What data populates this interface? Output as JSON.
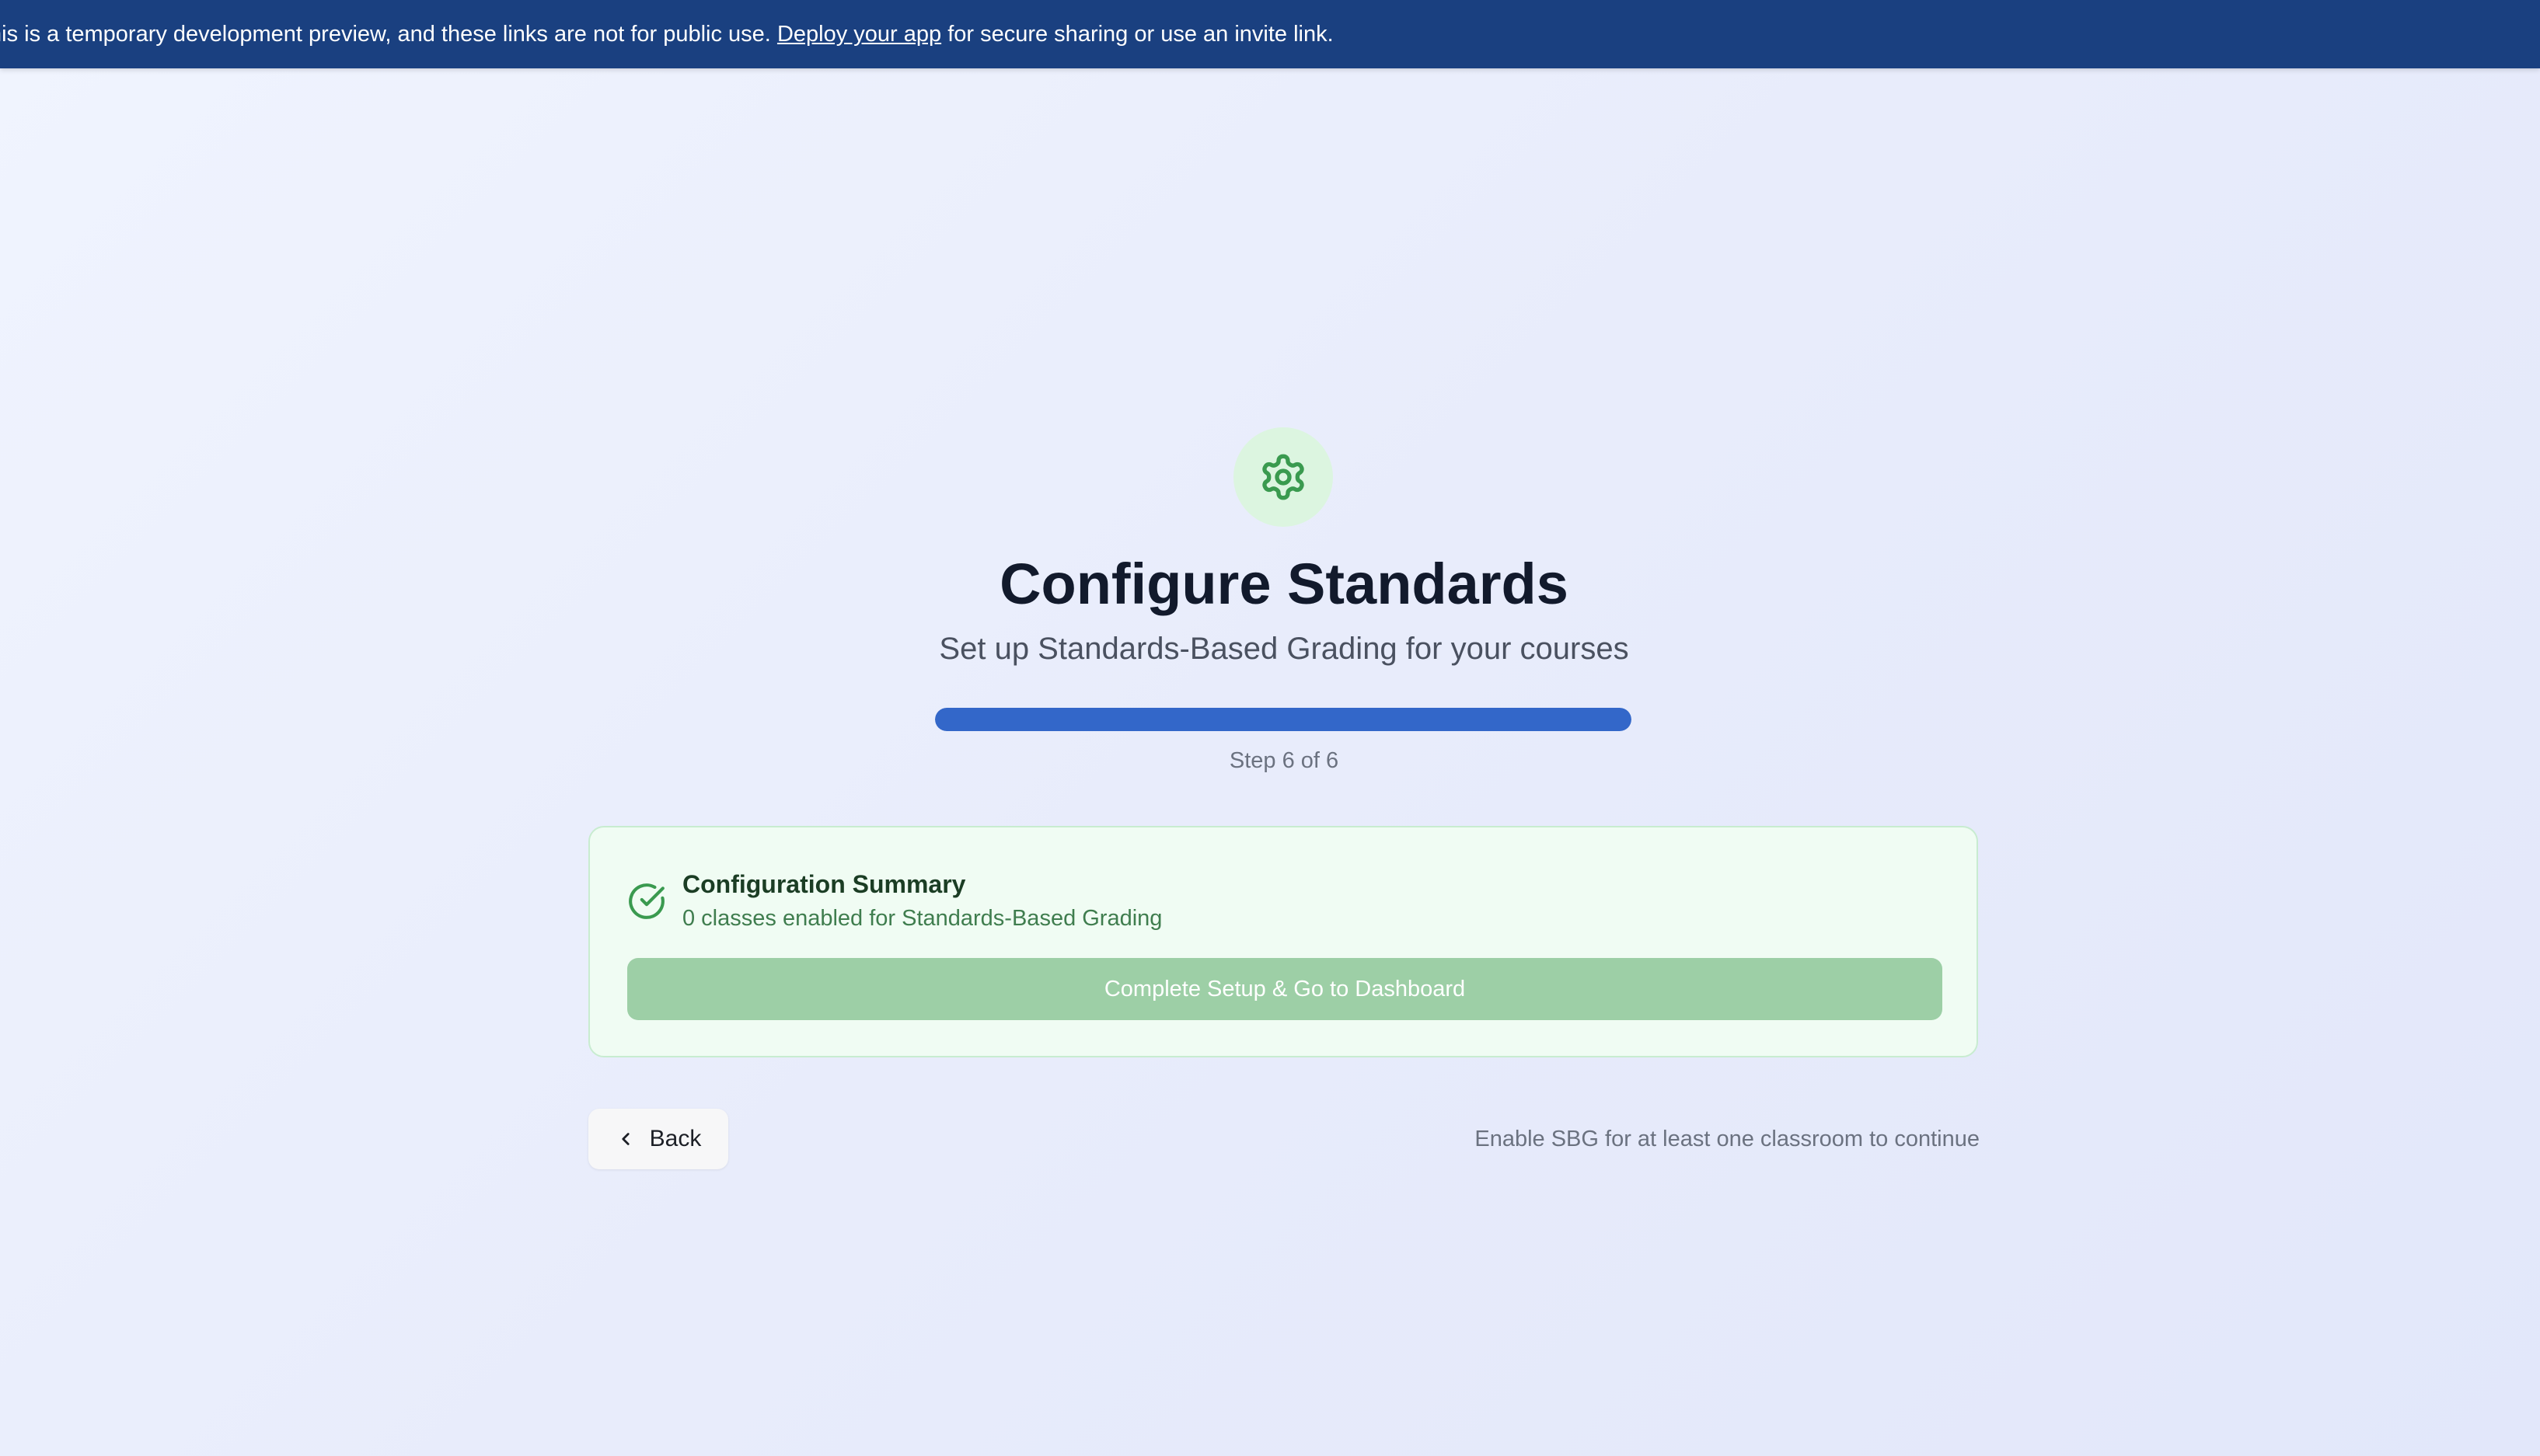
{
  "banner": {
    "text_before": "his is a temporary development preview, and these links are not for public use.",
    "link_text": "Deploy your app",
    "text_after": "for secure sharing or use an invite link."
  },
  "header": {
    "icon": "gear-icon",
    "title": "Configure Standards",
    "subtitle": "Set up Standards-Based Grading for your courses"
  },
  "progress": {
    "fraction": 1.0,
    "step_text": "Step 6 of 6"
  },
  "summary": {
    "icon": "check-circle-icon",
    "title": "Configuration Summary",
    "subtitle": "0 classes enabled for Standards-Based Grading",
    "button_label": "Complete Setup & Go to Dashboard"
  },
  "footer": {
    "back_label": "Back",
    "hint": "Enable SBG for at least one classroom to continue"
  },
  "colors": {
    "banner_bg": "#1a4080",
    "progress_fill": "#3367c9",
    "accent_green": "#3a9a4f",
    "button_disabled_green": "#9dcfa6"
  }
}
